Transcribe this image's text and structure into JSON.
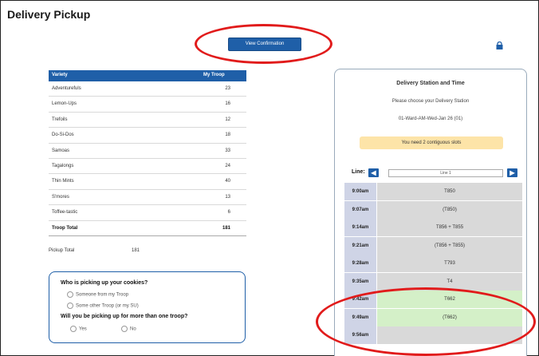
{
  "page": {
    "title": "Delivery Pickup"
  },
  "toolbar": {
    "view_confirmation_label": "View Confirmation",
    "lock_icon": "lock-icon"
  },
  "accent_color": "#1f5fa8",
  "highlight_color": "#e11b1b",
  "variety_table": {
    "headers": [
      "Variety",
      "My Troop"
    ],
    "rows": [
      {
        "variety": "Adventurefuls",
        "count": "23"
      },
      {
        "variety": "Lemon-Ups",
        "count": "16"
      },
      {
        "variety": "Trefoils",
        "count": "12"
      },
      {
        "variety": "Do-Si-Dos",
        "count": "18"
      },
      {
        "variety": "Samoas",
        "count": "33"
      },
      {
        "variety": "Tagalongs",
        "count": "24"
      },
      {
        "variety": "Thin Mints",
        "count": "40"
      },
      {
        "variety": "S'mores",
        "count": "13"
      },
      {
        "variety": "Toffee-tastic",
        "count": "6"
      }
    ],
    "total_label": "Troop Total",
    "total_value": "181"
  },
  "pickup_total": {
    "label": "Pickup Total",
    "value": "181"
  },
  "questions": {
    "q1": "Who is picking up your cookies?",
    "q1_options": [
      "Someone from my Troop",
      "Some other Troop (or my SU)"
    ],
    "q2": "Will you be picking up for more than one troop?",
    "q2_options": [
      "Yes",
      "No"
    ]
  },
  "station": {
    "title": "Delivery Station and Time",
    "prompt": "Please choose your Delivery Station",
    "selected_station": "01-Ward-AM-Wed-Jan 26 (01)",
    "warning": "You need 2 contiguous slots",
    "line_label": "Line:",
    "line_value": "Line 1",
    "slots": [
      {
        "time": "9:00am",
        "label": "T850",
        "status": "taken"
      },
      {
        "time": "9:07am",
        "label": "(T850)",
        "status": "taken"
      },
      {
        "time": "9:14am",
        "label": "T856 + T855",
        "status": "taken"
      },
      {
        "time": "9:21am",
        "label": "(T856 + T855)",
        "status": "taken"
      },
      {
        "time": "9:28am",
        "label": "T793",
        "status": "taken"
      },
      {
        "time": "9:35am",
        "label": "T4",
        "status": "taken"
      },
      {
        "time": "9:42am",
        "label": "T662",
        "status": "available"
      },
      {
        "time": "9:49am",
        "label": "(T662)",
        "status": "available"
      },
      {
        "time": "9:56am",
        "label": "",
        "status": "open"
      }
    ]
  }
}
